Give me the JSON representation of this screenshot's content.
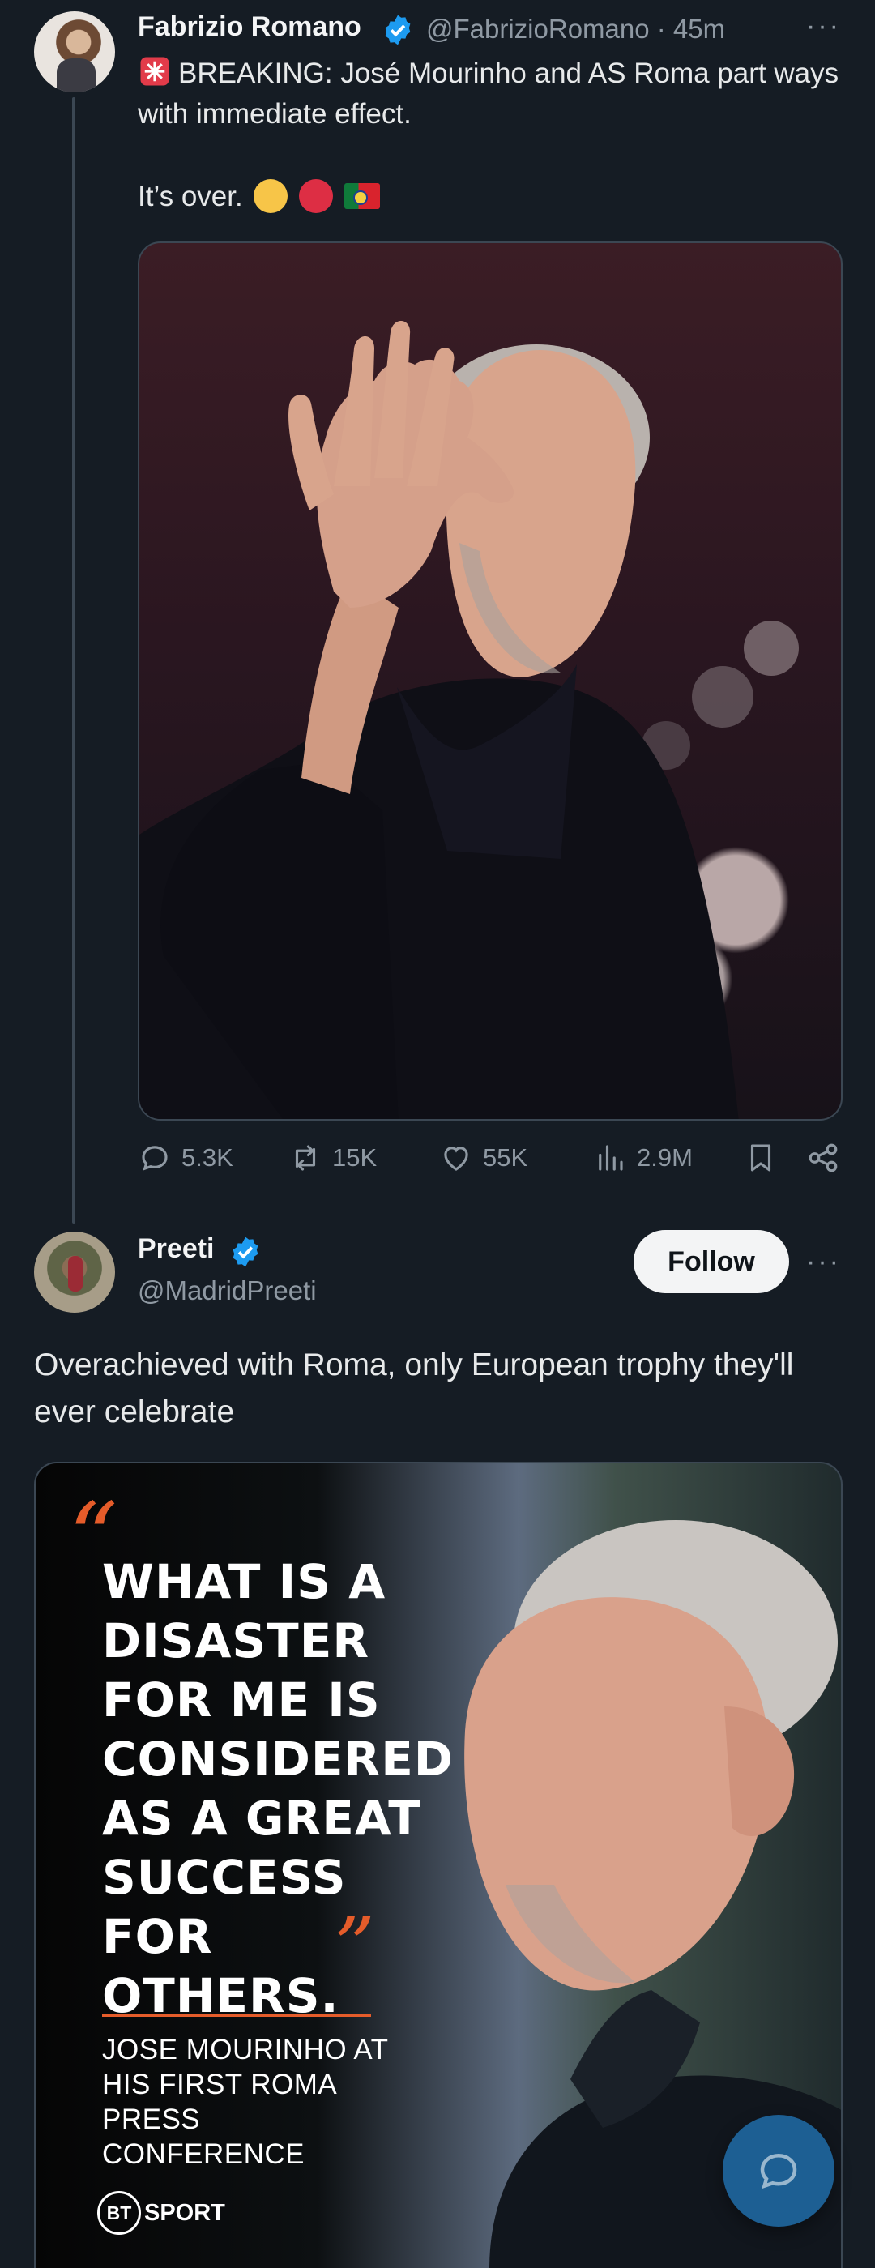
{
  "tweet1": {
    "author_name": "Fabrizio Romano",
    "handle_time": "@FabrizioRomano · 45m",
    "text_line": "BREAKING: José Mourinho and AS Roma part ways with immediate effect.",
    "text_second": "It’s over.",
    "more_label": "···",
    "actions": {
      "replies": "5.3K",
      "reposts": "15K",
      "likes": "55K",
      "views": "2.9M"
    },
    "emoji_colors": {
      "yellow": "#f7c548",
      "red": "#dd2e44"
    }
  },
  "tweet2": {
    "author_name": "Preeti",
    "handle": "@MadridPreeti",
    "follow_label": "Follow",
    "more_label": "···",
    "text": "Overachieved with Roma, only European trophy they'll ever celebrate",
    "media": {
      "quote_open": "“",
      "quote": "WHAT IS A DISASTER FOR ME IS CONSIDERED AS A GREAT SUCCESS FOR OTHERS.",
      "quote_close": "”",
      "attribution": "JOSE MOURINHO AT HIS FIRST ROMA PRESS CONFERENCE",
      "brand_badge": "BT",
      "brand_text": "SPORT"
    }
  },
  "colors": {
    "background": "#151c24",
    "verified_blue": "#1d9bf0",
    "accent_orange": "#e55c2a",
    "fab_blue": "#1d5f93"
  }
}
